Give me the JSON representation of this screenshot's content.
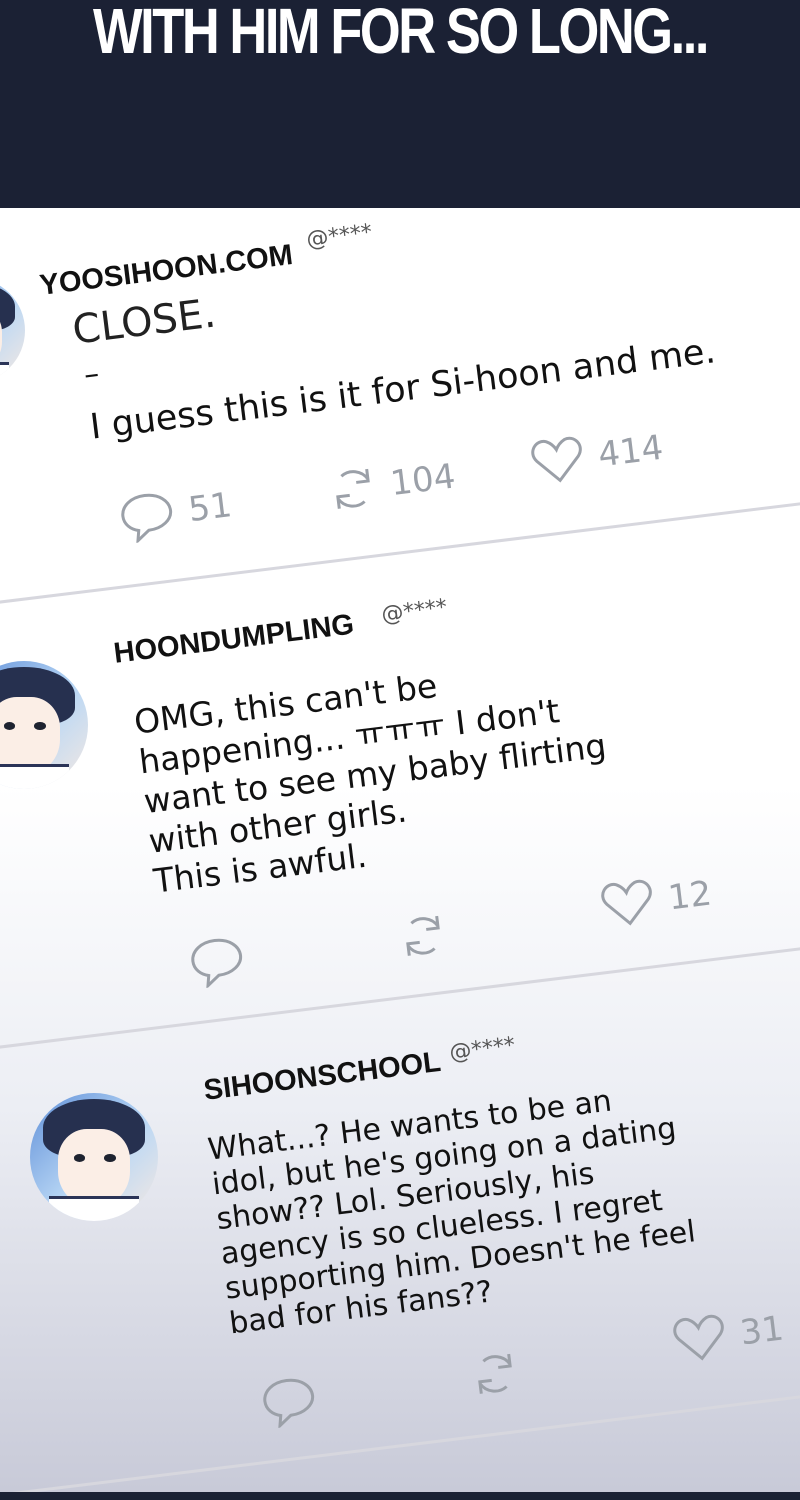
{
  "banner": {
    "title": "WITH HIM FOR SO LONG..."
  },
  "posts": [
    {
      "username": "YOOSIHOON.COM",
      "handle": "@****",
      "line1": "CLOSE.",
      "line2": "–",
      "line3": "I guess this is it for Si-hoon and me.",
      "comments": "51",
      "reposts": "104",
      "likes": "414"
    },
    {
      "username": "HOONDUMPLING",
      "handle": "@****",
      "text": "OMG, this can't be\nhappening... ㅠㅠㅠ I don't\nwant to see my baby flirting\nwith other girls.\nThis is awful.",
      "likes": "12"
    },
    {
      "username": "SIHOONSCHOOL",
      "handle": "@****",
      "text": "What...? He wants to be an\nidol, but he's going on a dating\nshow?? Lol. Seriously, his\nagency is so clueless. I regret\nsupporting him. Doesn't he feel\nbad for his fans??",
      "likes": "31"
    }
  ],
  "icons": [
    "comment-icon",
    "repost-icon",
    "heart-icon"
  ]
}
